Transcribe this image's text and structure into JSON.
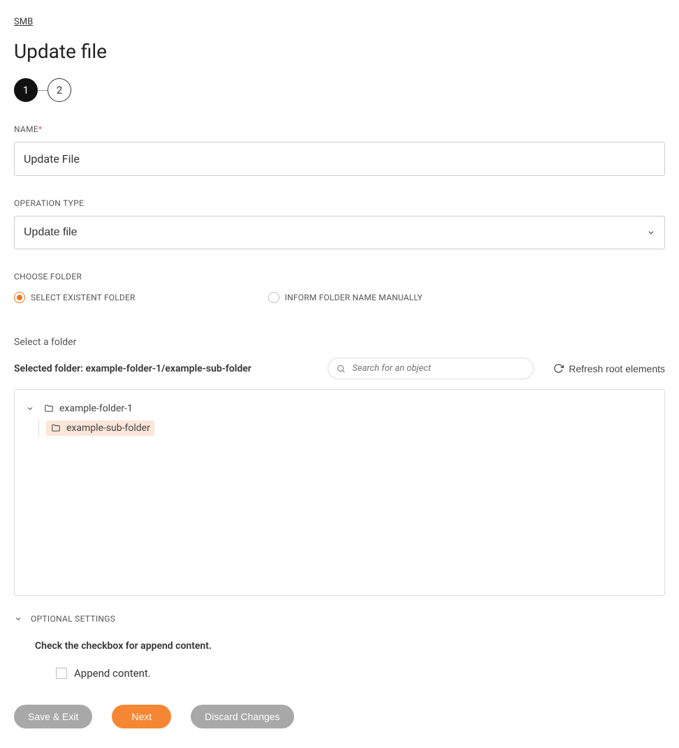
{
  "breadcrumb": "SMB",
  "page_title": "Update file",
  "stepper": {
    "step1": "1",
    "step2": "2"
  },
  "fields": {
    "name_label": "NAME",
    "name_value": "Update File",
    "op_label": "OPERATION TYPE",
    "op_value": "Update file",
    "choose_label": "CHOOSE FOLDER",
    "radio_existent": "SELECT EXISTENT FOLDER",
    "radio_manual": "INFORM FOLDER NAME MANUALLY"
  },
  "folder": {
    "select_heading": "Select a folder",
    "selected_prefix": "Selected folder: ",
    "selected_path": "example-folder-1/example-sub-folder",
    "search_placeholder": "Search for an object",
    "refresh_label": "Refresh root elements",
    "tree": {
      "root_name": "example-folder-1",
      "child_name": "example-sub-folder"
    }
  },
  "optional": {
    "header": "OPTIONAL SETTINGS",
    "hint": "Check the checkbox for append content.",
    "append_label": "Append content."
  },
  "buttons": {
    "save_exit": "Save & Exit",
    "next": "Next",
    "discard": "Discard Changes"
  }
}
